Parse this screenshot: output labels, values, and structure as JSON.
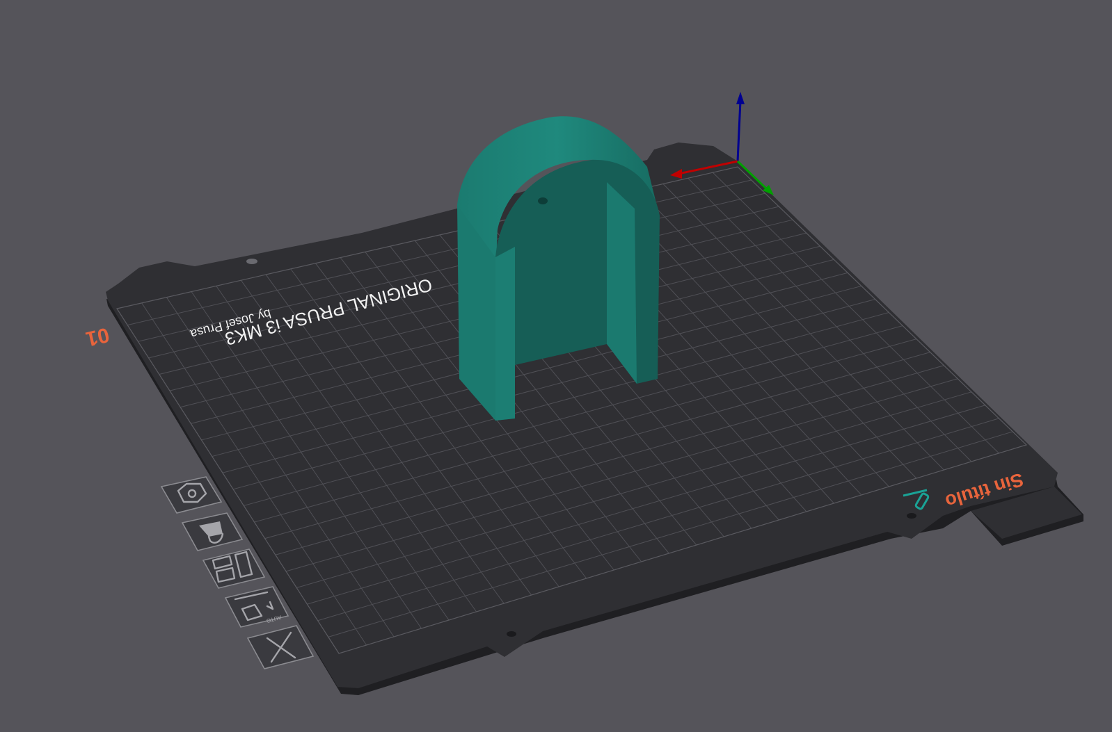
{
  "app": {
    "colors": {
      "background": "#55545a",
      "bed": "#2f2f33",
      "grid": "#505056",
      "model": "#1d8276",
      "model_dark": "#135a52",
      "label_accent": "#e8643c",
      "axis_x": "#c00000",
      "axis_y": "#00a000",
      "axis_z": "#000090"
    }
  },
  "bed": {
    "brand_line": "ORIGINAL PRUSA i3  MK3",
    "by_line": "by Josef Prusa",
    "plate_number": "01",
    "project_title": "Sin título"
  },
  "toolbar": {
    "items": [
      {
        "icon": "settings-hex-icon"
      },
      {
        "icon": "paint-bucket-icon"
      },
      {
        "icon": "arrange-icon"
      },
      {
        "icon": "auto-orient-icon",
        "label": "AUTO"
      },
      {
        "icon": "close-x-icon"
      }
    ]
  }
}
